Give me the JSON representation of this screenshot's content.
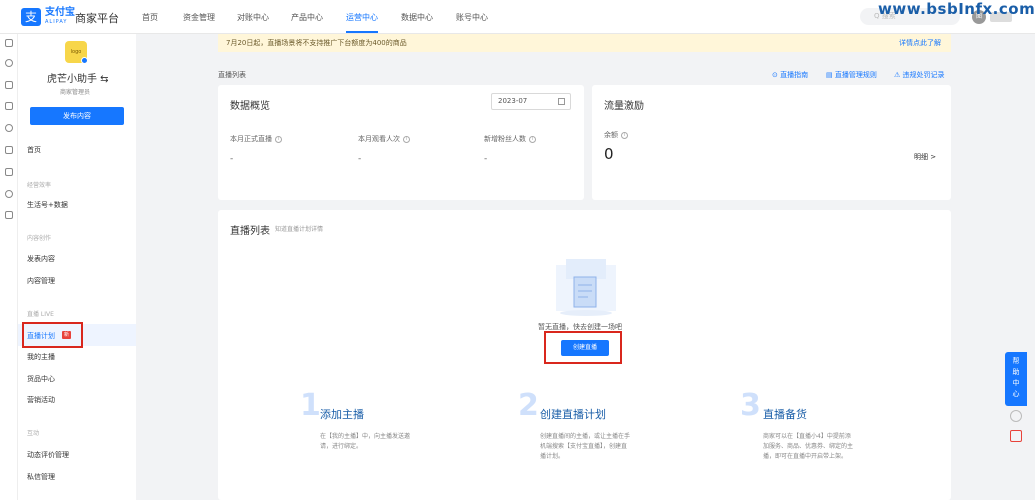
{
  "topnav": {
    "logo_glyph": "支",
    "logo_text": "支付宝",
    "logo_sub": "ALIPAY",
    "platform": "商家平台",
    "items": [
      "首页",
      "资金管理",
      "对账中心",
      "产品中心",
      "运营中心",
      "数据中心",
      "账号中心"
    ],
    "active_index": 4,
    "search_placeholder": "Q 搜索",
    "avatar": "图"
  },
  "watermark": "www.bsbInfx.com",
  "sidebar": {
    "avatar_text": "logo",
    "shop_name": "虎芒小助手 ⇆",
    "shop_role": "商家管理员",
    "publish_button": "发布内容",
    "home": "首页",
    "group_business": "经营效率",
    "life_account": "生活号+数据",
    "group_content": "内容创作",
    "publish_content": "发表内容",
    "content_mgmt": "内容管理",
    "group_live": "直播 LIVE",
    "live_plan": "直播计划",
    "new_tag": "新",
    "my_host": "我的主播",
    "gift_center": "货品中心",
    "marketing": "营销活动",
    "group_interact": "互动",
    "comment_mgmt": "动态评价管理",
    "private_msg": "私信管理"
  },
  "notice": {
    "text": "7月20日起，直播场景将不支持推广下台额度为400的商品",
    "link": "详情点此了解"
  },
  "page": {
    "section_title": "直播列表",
    "links": [
      "⊙ 直播指南",
      "▤ 直播管理规则",
      "⚠ 违规处罚记录"
    ]
  },
  "data_overview": {
    "title": "数据概览",
    "date": "2023-07",
    "metrics": [
      {
        "label": "本月正式直播",
        "value": "-"
      },
      {
        "label": "本月观看人次",
        "value": "-"
      },
      {
        "label": "新增粉丝人数",
        "value": "-"
      }
    ]
  },
  "traffic": {
    "title": "流量激励",
    "balance_label": "余额",
    "balance_value": "0",
    "detail_link": "明细 >"
  },
  "live_list": {
    "title": "直播列表",
    "subtitle": "知道直播计划详情",
    "empty_text": "暂无直播，快去创建一场吧",
    "create_button": "创建直播"
  },
  "steps": [
    {
      "num": "1",
      "title": "添加主播",
      "desc": "在【我的主播】中，向主播发送邀请，进行绑定。"
    },
    {
      "num": "2",
      "title": "创建直播计划",
      "desc": "创建直播间的主播，或让主播在手机端搜索【支付宝直播】，创建直播计划。"
    },
    {
      "num": "3",
      "title": "直播备货",
      "desc": "商家可以在【直播小4】中提前添加服务、商品、优惠券、绑定的主播，即可在直播中开启带上架。"
    }
  ],
  "help": {
    "label": "帮\n助\n中\n心"
  }
}
